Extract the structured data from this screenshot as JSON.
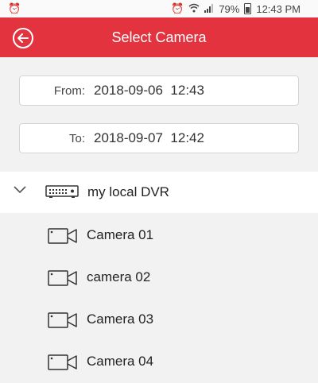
{
  "status_bar": {
    "left_icon": "alarm-clock-icon",
    "battery": "79%",
    "time": "12:43 PM"
  },
  "header": {
    "title": "Select Camera",
    "back_icon": "back-arrow-icon",
    "background": "#e2333f"
  },
  "range": {
    "from_label": "From:",
    "from_value": "2018-09-06  12:43",
    "to_label": "To:",
    "to_value": "2018-09-07  12:42"
  },
  "device": {
    "name": "my local DVR",
    "expanded": true,
    "cameras": [
      {
        "label": "Camera 01"
      },
      {
        "label": "camera 02"
      },
      {
        "label": "Camera 03"
      },
      {
        "label": "Camera 04"
      }
    ]
  }
}
